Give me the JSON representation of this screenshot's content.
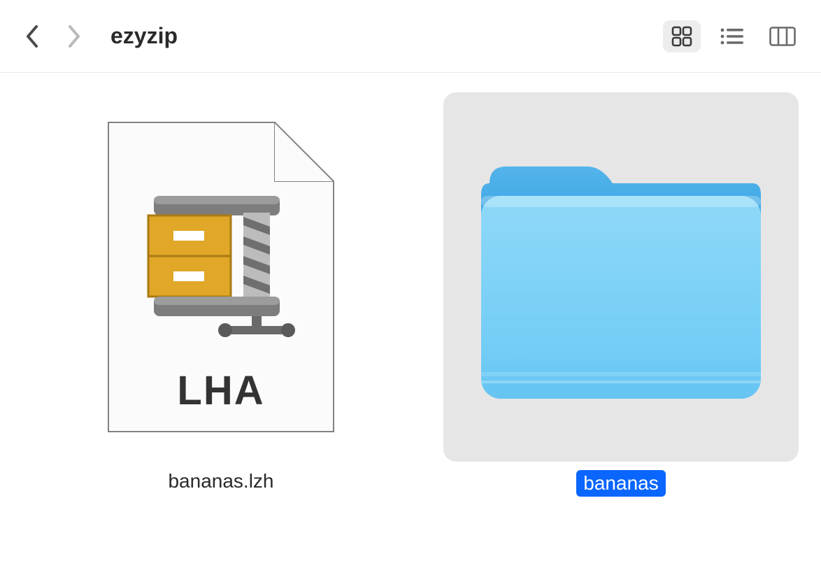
{
  "toolbar": {
    "title": "ezyzip",
    "nav": {
      "back_enabled": true,
      "forward_enabled": false
    },
    "view_mode": "icon"
  },
  "items": [
    {
      "type": "archive",
      "file_format_label": "LHA",
      "filename": "bananas.lzh",
      "selected": false
    },
    {
      "type": "folder",
      "filename": "bananas",
      "selected": true
    }
  ],
  "icons": {
    "back": "chevron-left-icon",
    "forward": "chevron-right-icon",
    "view_icon": "grid-view-icon",
    "view_list": "list-view-icon",
    "view_column": "column-view-icon"
  },
  "colors": {
    "selection_bg": "#e6e6e6",
    "selection_label_bg": "#0a66ff",
    "folder_tab": "#3ca7e6",
    "folder_front": "#73cdf6",
    "archive_accent": "#e0a728"
  }
}
